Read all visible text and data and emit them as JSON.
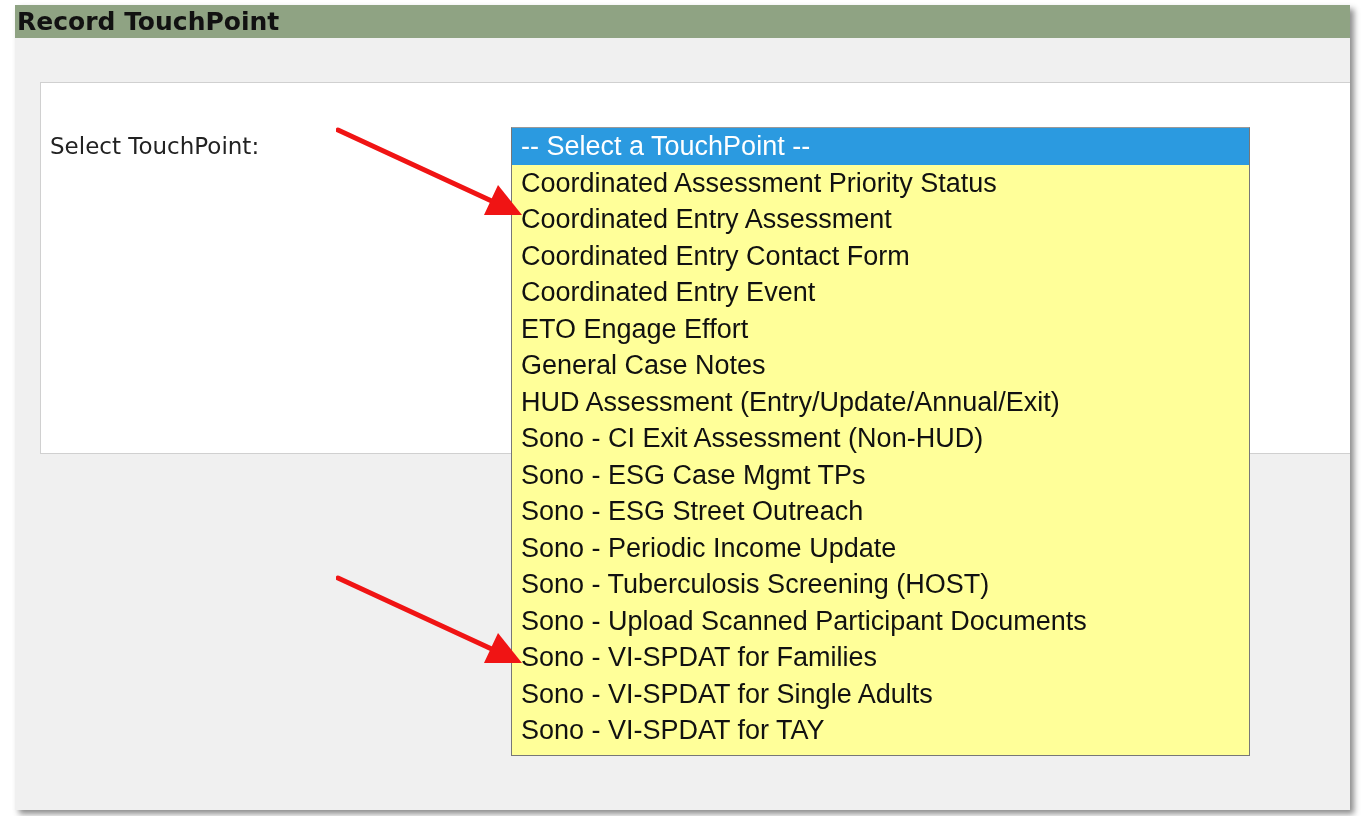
{
  "header": {
    "title": "Record TouchPoint"
  },
  "field": {
    "label": "Select TouchPoint:"
  },
  "listbox": {
    "options": [
      {
        "label": "-- Select a TouchPoint --",
        "selected": true
      },
      {
        "label": "Coordinated Assessment Priority Status",
        "selected": false
      },
      {
        "label": "Coordinated Entry Assessment",
        "selected": false
      },
      {
        "label": "Coordinated Entry Contact Form",
        "selected": false
      },
      {
        "label": "Coordinated Entry Event",
        "selected": false
      },
      {
        "label": "ETO Engage Effort",
        "selected": false
      },
      {
        "label": "General Case Notes",
        "selected": false
      },
      {
        "label": "HUD Assessment (Entry/Update/Annual/Exit)",
        "selected": false
      },
      {
        "label": "Sono - CI Exit Assessment (Non-HUD)",
        "selected": false
      },
      {
        "label": "Sono - ESG Case Mgmt TPs",
        "selected": false
      },
      {
        "label": "Sono - ESG Street Outreach",
        "selected": false
      },
      {
        "label": "Sono - Periodic Income Update",
        "selected": false
      },
      {
        "label": "Sono - Tuberculosis Screening (HOST)",
        "selected": false
      },
      {
        "label": "Sono - Upload Scanned Participant Documents",
        "selected": false
      },
      {
        "label": "Sono - VI-SPDAT for Families",
        "selected": false
      },
      {
        "label": "Sono - VI-SPDAT for Single Adults",
        "selected": false
      },
      {
        "label": "Sono - VI-SPDAT for TAY",
        "selected": false
      }
    ]
  }
}
